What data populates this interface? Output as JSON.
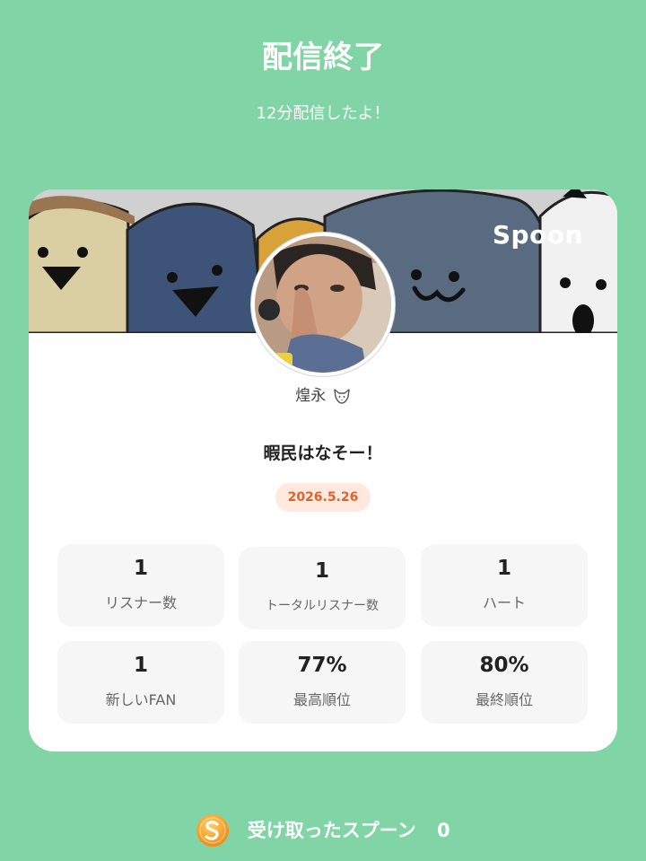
{
  "header": {
    "title": "配信終了",
    "subtitle": "12分配信したよ！"
  },
  "card": {
    "brand": "Spoon",
    "username": "煌永",
    "stream_title": "暇民はなそー！",
    "date": "2026.5.26",
    "stats": [
      {
        "value": "1",
        "label": "リスナー数"
      },
      {
        "value": "1",
        "label": "トータルリスナー数"
      },
      {
        "value": "1",
        "label": "ハート"
      },
      {
        "value": "1",
        "label": "新しいFAN"
      },
      {
        "value": "77%",
        "label": "最高順位"
      },
      {
        "value": "80%",
        "label": "最終順位"
      }
    ]
  },
  "footer": {
    "label": "受け取ったスプーン",
    "count": "0"
  },
  "icons": {
    "coin": "spoon-coin-icon",
    "fox": "fox-face-icon"
  },
  "colors": {
    "background": "#81d4a5",
    "badge_bg": "#ffe9de",
    "badge_text": "#e0632b",
    "coin": "#f29a24"
  }
}
